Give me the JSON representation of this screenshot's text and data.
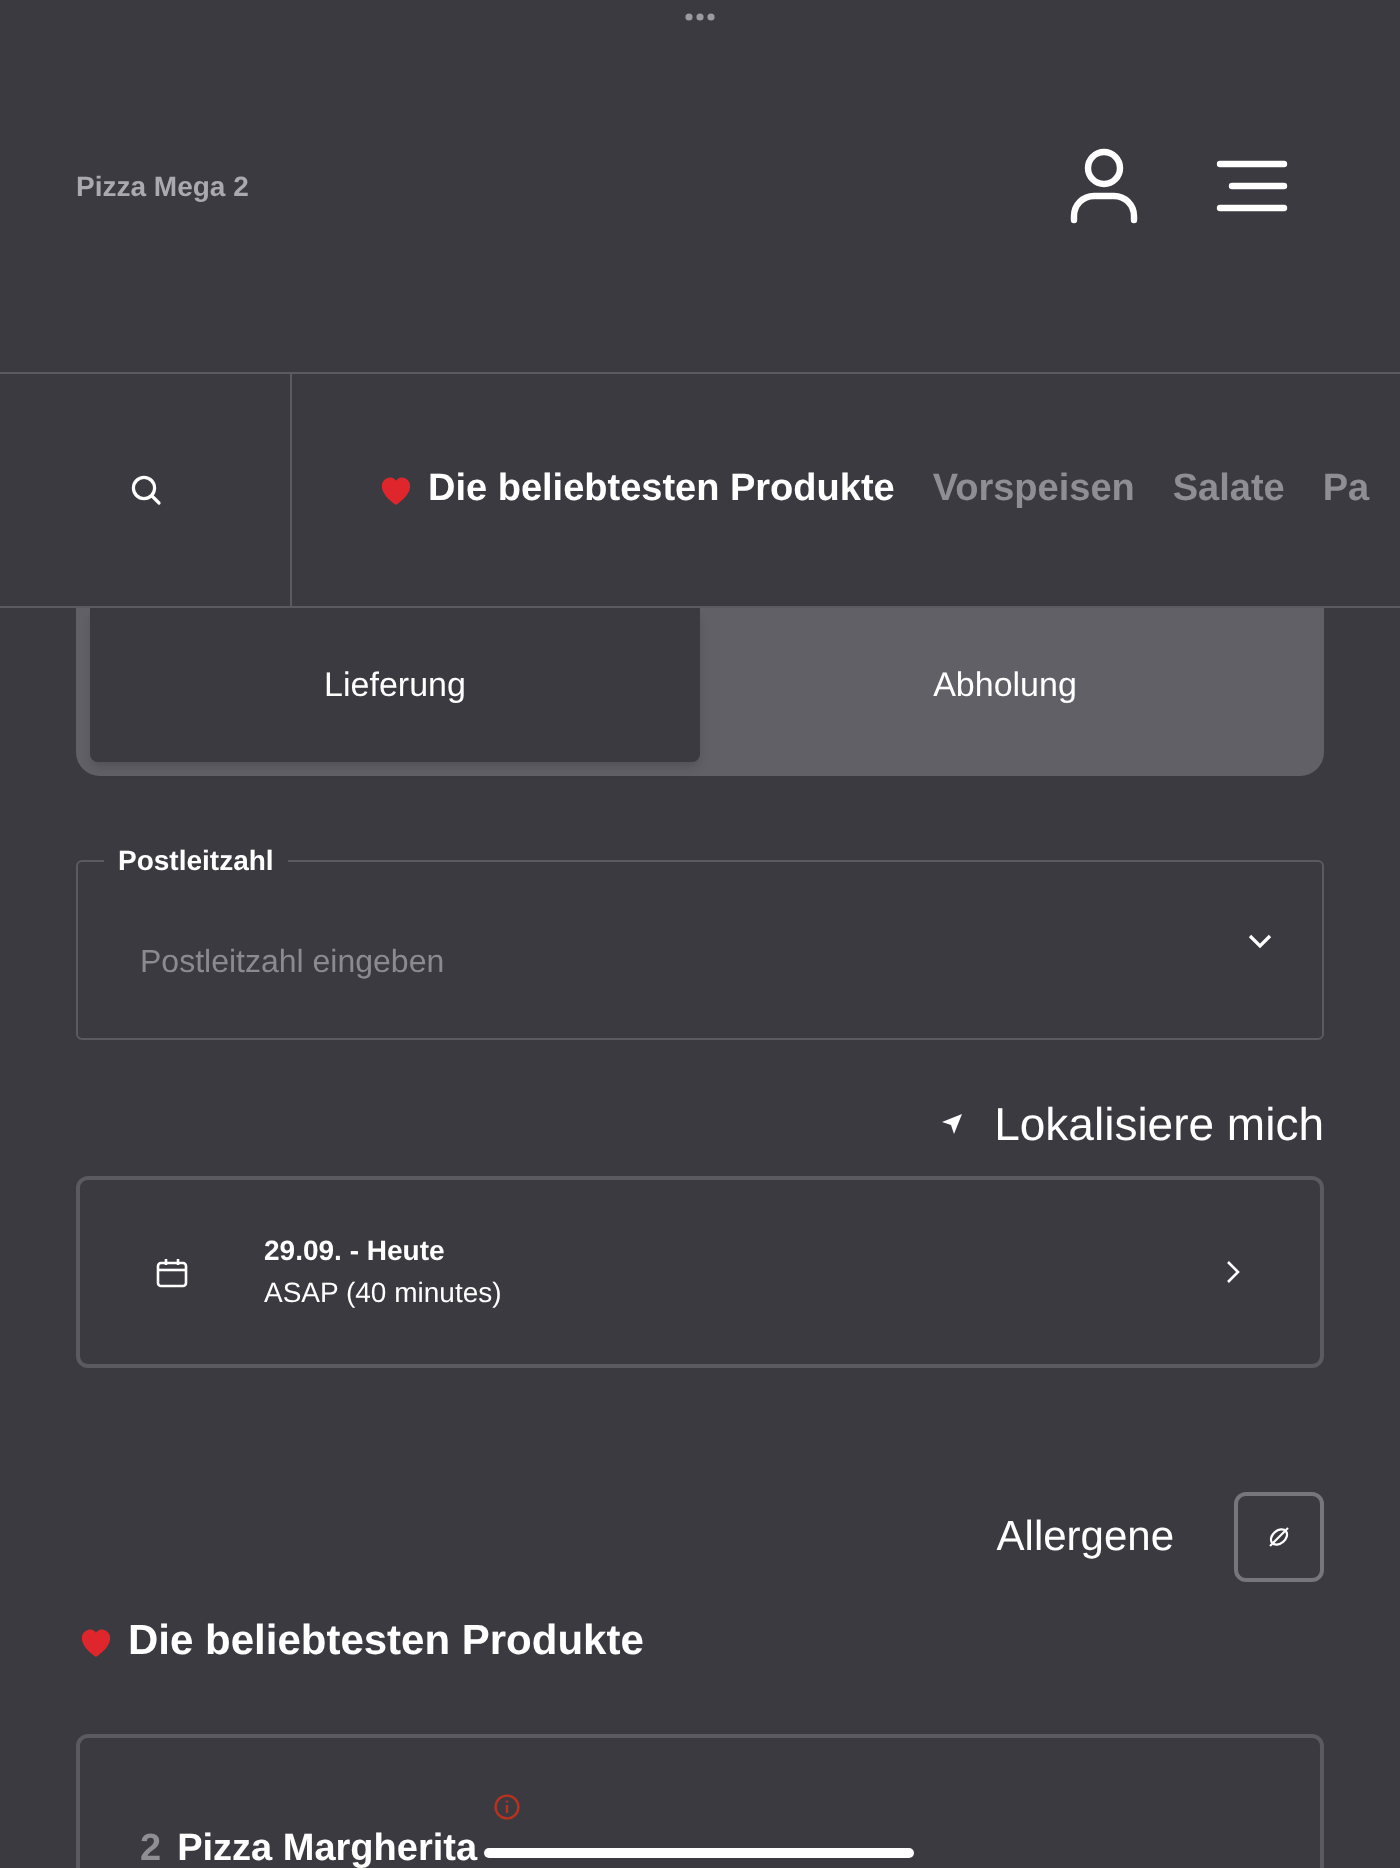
{
  "header": {
    "title": "Pizza Mega 2"
  },
  "categories": [
    {
      "label": "Die beliebtesten Produkte",
      "selected": true,
      "favorite": true
    },
    {
      "label": "Vorspeisen",
      "selected": false,
      "favorite": false
    },
    {
      "label": "Salate",
      "selected": false,
      "favorite": false
    },
    {
      "label": "Pa",
      "selected": false,
      "favorite": false
    }
  ],
  "order_modes": [
    {
      "label": "Lieferung",
      "selected": true
    },
    {
      "label": "Abholung",
      "selected": false
    }
  ],
  "postcode": {
    "label": "Postleitzahl",
    "placeholder": "Postleitzahl eingeben"
  },
  "locate": {
    "label": "Lokalisiere mich"
  },
  "time_slot": {
    "date": "29.09. - Heute",
    "time": "ASAP (40 minutes)"
  },
  "allergens": {
    "label": "Allergene"
  },
  "section": {
    "title": "Die beliebtesten Produkte"
  },
  "products": [
    {
      "quantity": "2",
      "name": "Pizza Margherita"
    }
  ]
}
